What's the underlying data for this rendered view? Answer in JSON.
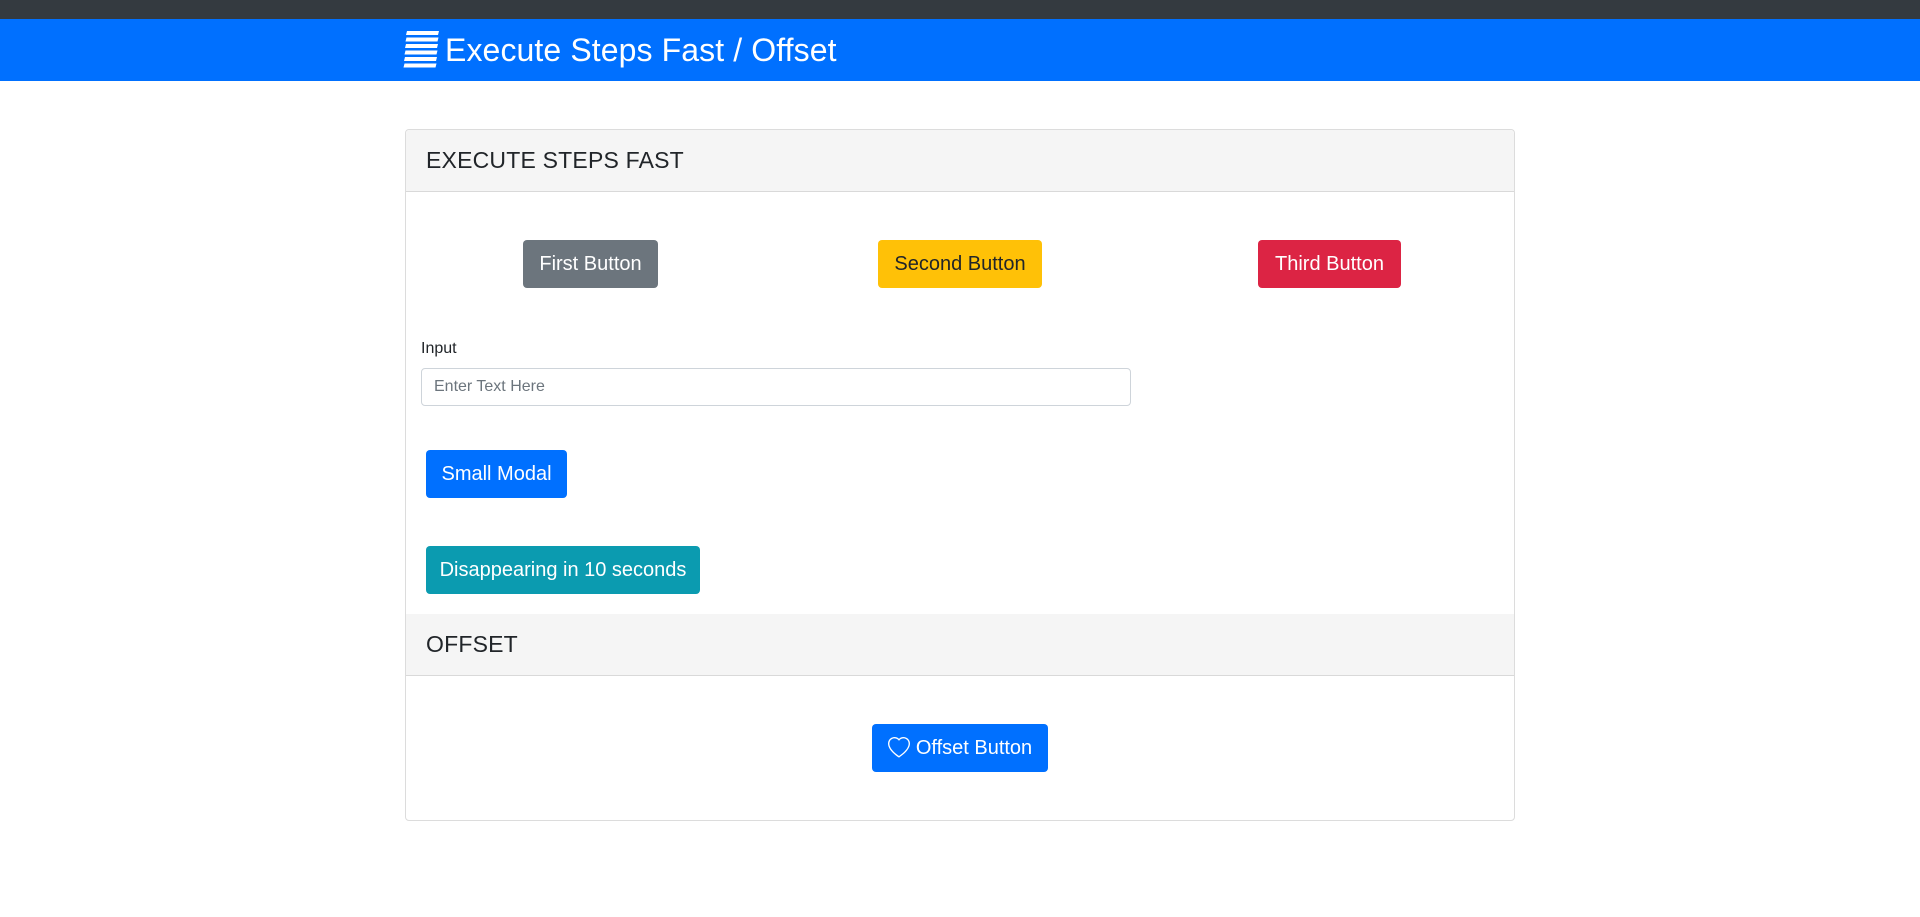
{
  "navbar": {
    "title": "Execute Steps Fast / Offset",
    "logo_icon": "stacked-lines-logo-icon",
    "background_color": "#0070ff",
    "top_strip_color": "#343a40"
  },
  "sections": {
    "execute": {
      "title": "EXECUTE STEPS FAST",
      "buttons": {
        "first": "First Button",
        "second": "Second Button",
        "third": "Third Button"
      },
      "input": {
        "label": "Input",
        "placeholder": "Enter Text Here",
        "value": ""
      },
      "small_modal_label": "Small Modal",
      "disappearing_label": "Disappearing in 10 seconds"
    },
    "offset": {
      "title": "OFFSET",
      "button_label": "Offset Button",
      "button_icon": "heart-icon"
    }
  },
  "colors": {
    "primary": "#0070ff",
    "secondary": "#6c757d",
    "warning": "#ffc107",
    "danger": "#dc2444",
    "info": "#0b9bb0"
  }
}
